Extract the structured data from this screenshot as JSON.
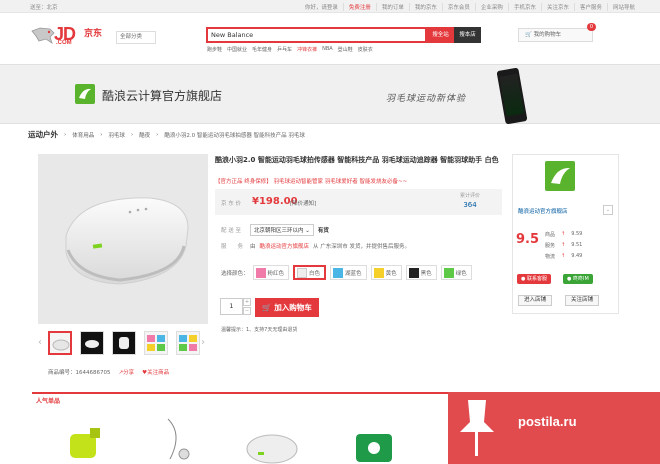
{
  "topbar": {
    "location": "送至：北京",
    "links": [
      "你好，请登录",
      "免费注册",
      "我的订单",
      "我的京东",
      "京东会员",
      "企业采购",
      "手机京东",
      "关注京东",
      "客户服务",
      "网站导航"
    ]
  },
  "logo": {
    "text": "JD",
    "domain": ".COM",
    "cn": "京东"
  },
  "category_button": "全部分类",
  "search": {
    "value": "New Balance",
    "btn_all": "搜全站",
    "btn_store": "搜本店"
  },
  "hot_words": [
    "跑步鞋",
    "中国就业",
    "毛年健身",
    "乒乓车",
    "冲锋衣裤",
    "NBA",
    "登山鞋",
    "皮肤衣"
  ],
  "cart": {
    "label": "我的购物车",
    "count": "0"
  },
  "banner": {
    "store_name": "酷浪云计算官方旗舰店",
    "slogan": "羽毛球运动新体验"
  },
  "breadcrumb": [
    "运动户外",
    "体育用品",
    "羽毛球",
    "酷夜",
    "酷浪小羽2.0 智能运动羽毛球拍感器 智能科技产品 羽毛球"
  ],
  "product": {
    "title": "酷浪小羽2.0 智能运动羽毛球拍传感器 智能科技产品 羽毛球运动追踪器 智能羽球助手 白色",
    "promo": "【官方正品 终身保修】 羽毛球运动智能管家 羽毛球爱好者 智能发烧友必备~~",
    "price_label": "京 东 价",
    "price": "¥198.00",
    "notify": "[降价通知]",
    "review_label": "累计评价",
    "review_count": "364",
    "delivery_label": "配 送 至",
    "address": "北京朝阳区三环以内",
    "stock": "有货",
    "service_label": "服　　务",
    "service_text": "由",
    "seller": "酷浪运动官方旗舰店",
    "service_rest": "从 广东深圳市 发货，并提供售后服务。",
    "color_label": "选择颜色：",
    "colors": [
      {
        "name": "粉红色",
        "color": "#f07aa8"
      },
      {
        "name": "白色",
        "color": "#eeeeee"
      },
      {
        "name": "湖蓝色",
        "color": "#49b6e6"
      },
      {
        "name": "黄色",
        "color": "#f5d02b"
      },
      {
        "name": "黑色",
        "color": "#222222"
      },
      {
        "name": "绿色",
        "color": "#5ec946"
      }
    ],
    "selected_color": "白色",
    "quantity": "1",
    "add_cart": "加入购物车",
    "tips": "温馨提示：1、支持7天无理由退货",
    "item_no": "商品编号：1644686705",
    "share": "分享",
    "follow": "关注商品"
  },
  "store": {
    "name": "酷浪运动官方旗舰店",
    "score": "9.5",
    "ratings": [
      {
        "label": "商品",
        "value": "9.59"
      },
      {
        "label": "服务",
        "value": "9.51"
      },
      {
        "label": "物流",
        "value": "9.49"
      }
    ],
    "badge1": "联系客服",
    "badge2": "咚咚IM",
    "btn_enter": "进入店铺",
    "btn_follow": "关注店铺"
  },
  "popular": {
    "title": "人气单品"
  },
  "watermark": {
    "text": "postila.ru"
  },
  "colors": {
    "accent": "#e4393c",
    "brand_green": "#59b32c",
    "link_blue": "#005aa0"
  }
}
